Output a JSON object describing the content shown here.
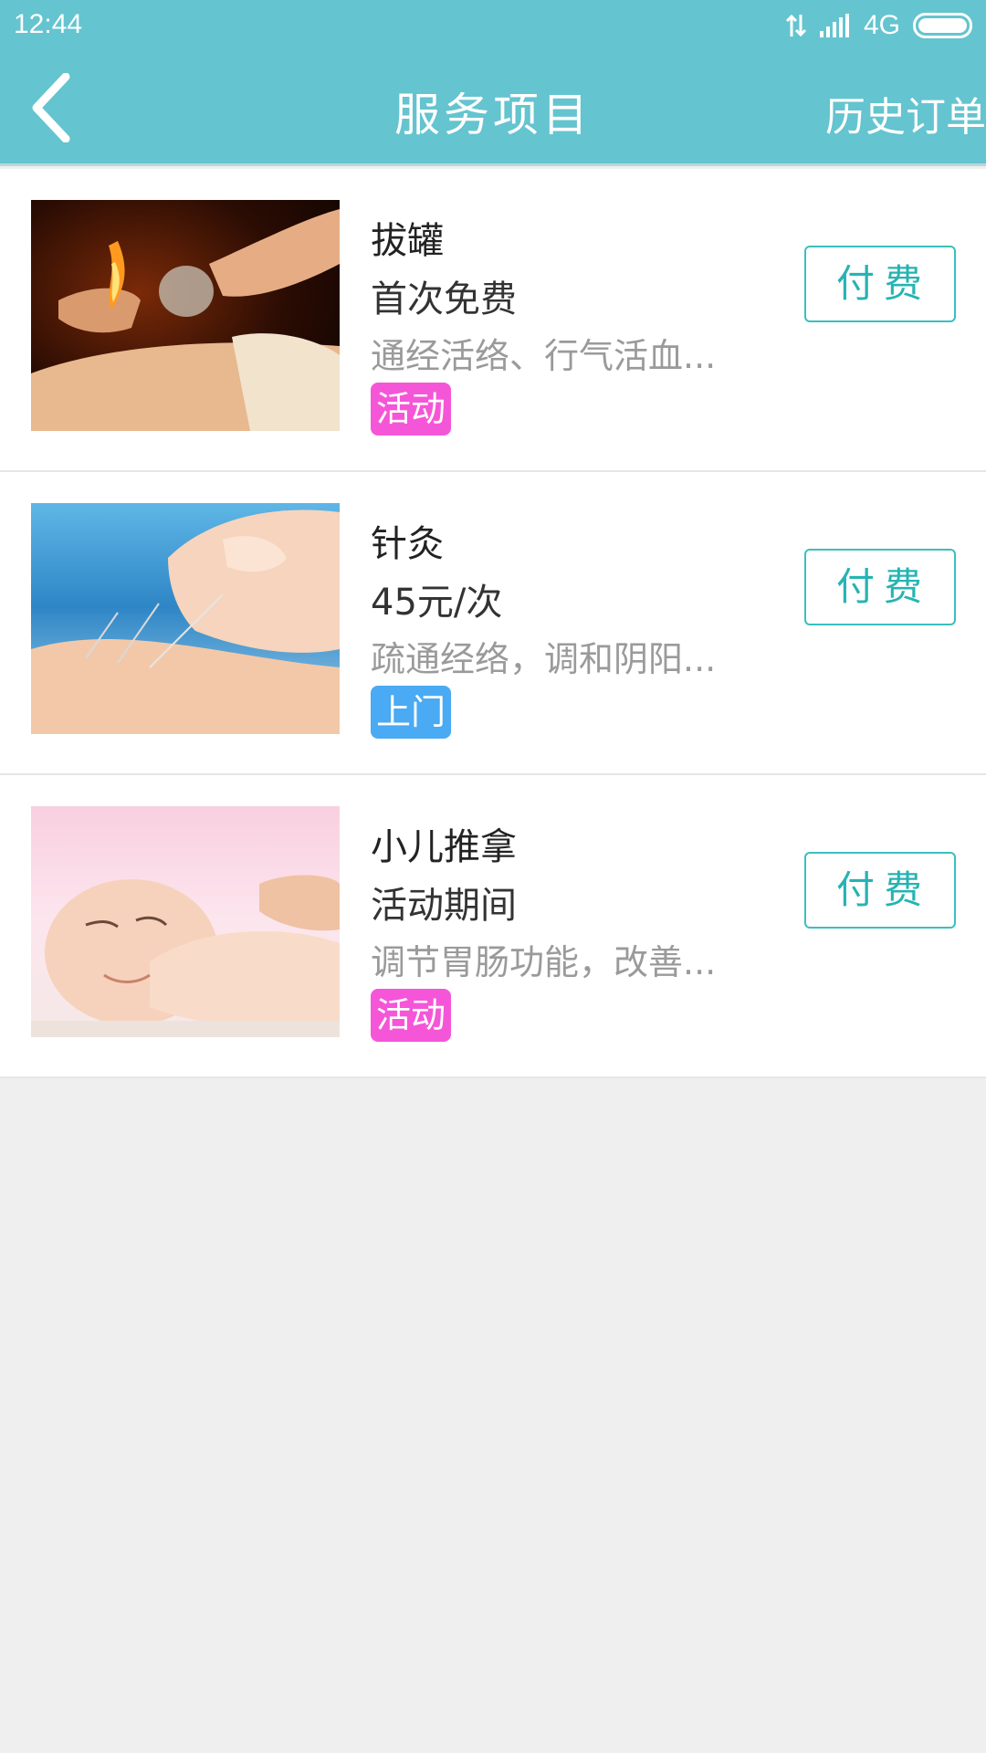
{
  "status_bar": {
    "time": "12:44",
    "network": "4G"
  },
  "header": {
    "title": "服务项目",
    "history": "历史订单"
  },
  "items": [
    {
      "name": "拔罐",
      "price": "首次免费",
      "desc": "通经活络、行气活血...",
      "tag": "活动",
      "tag_color": "#f556d8",
      "button": "付费"
    },
    {
      "name": "针灸",
      "price": "45元/次",
      "desc": "疏通经络，调和阴阳...",
      "tag": "上门",
      "tag_color": "#4aaaf3",
      "button": "付费"
    },
    {
      "name": "小儿推拿",
      "price": "活动期间",
      "desc": "调节胃肠功能，改善...",
      "tag": "活动",
      "tag_color": "#f556d8",
      "button": "付费"
    }
  ],
  "colors": {
    "primary": "#64c4cf",
    "button": "#27b3b3",
    "background": "#efefef"
  }
}
